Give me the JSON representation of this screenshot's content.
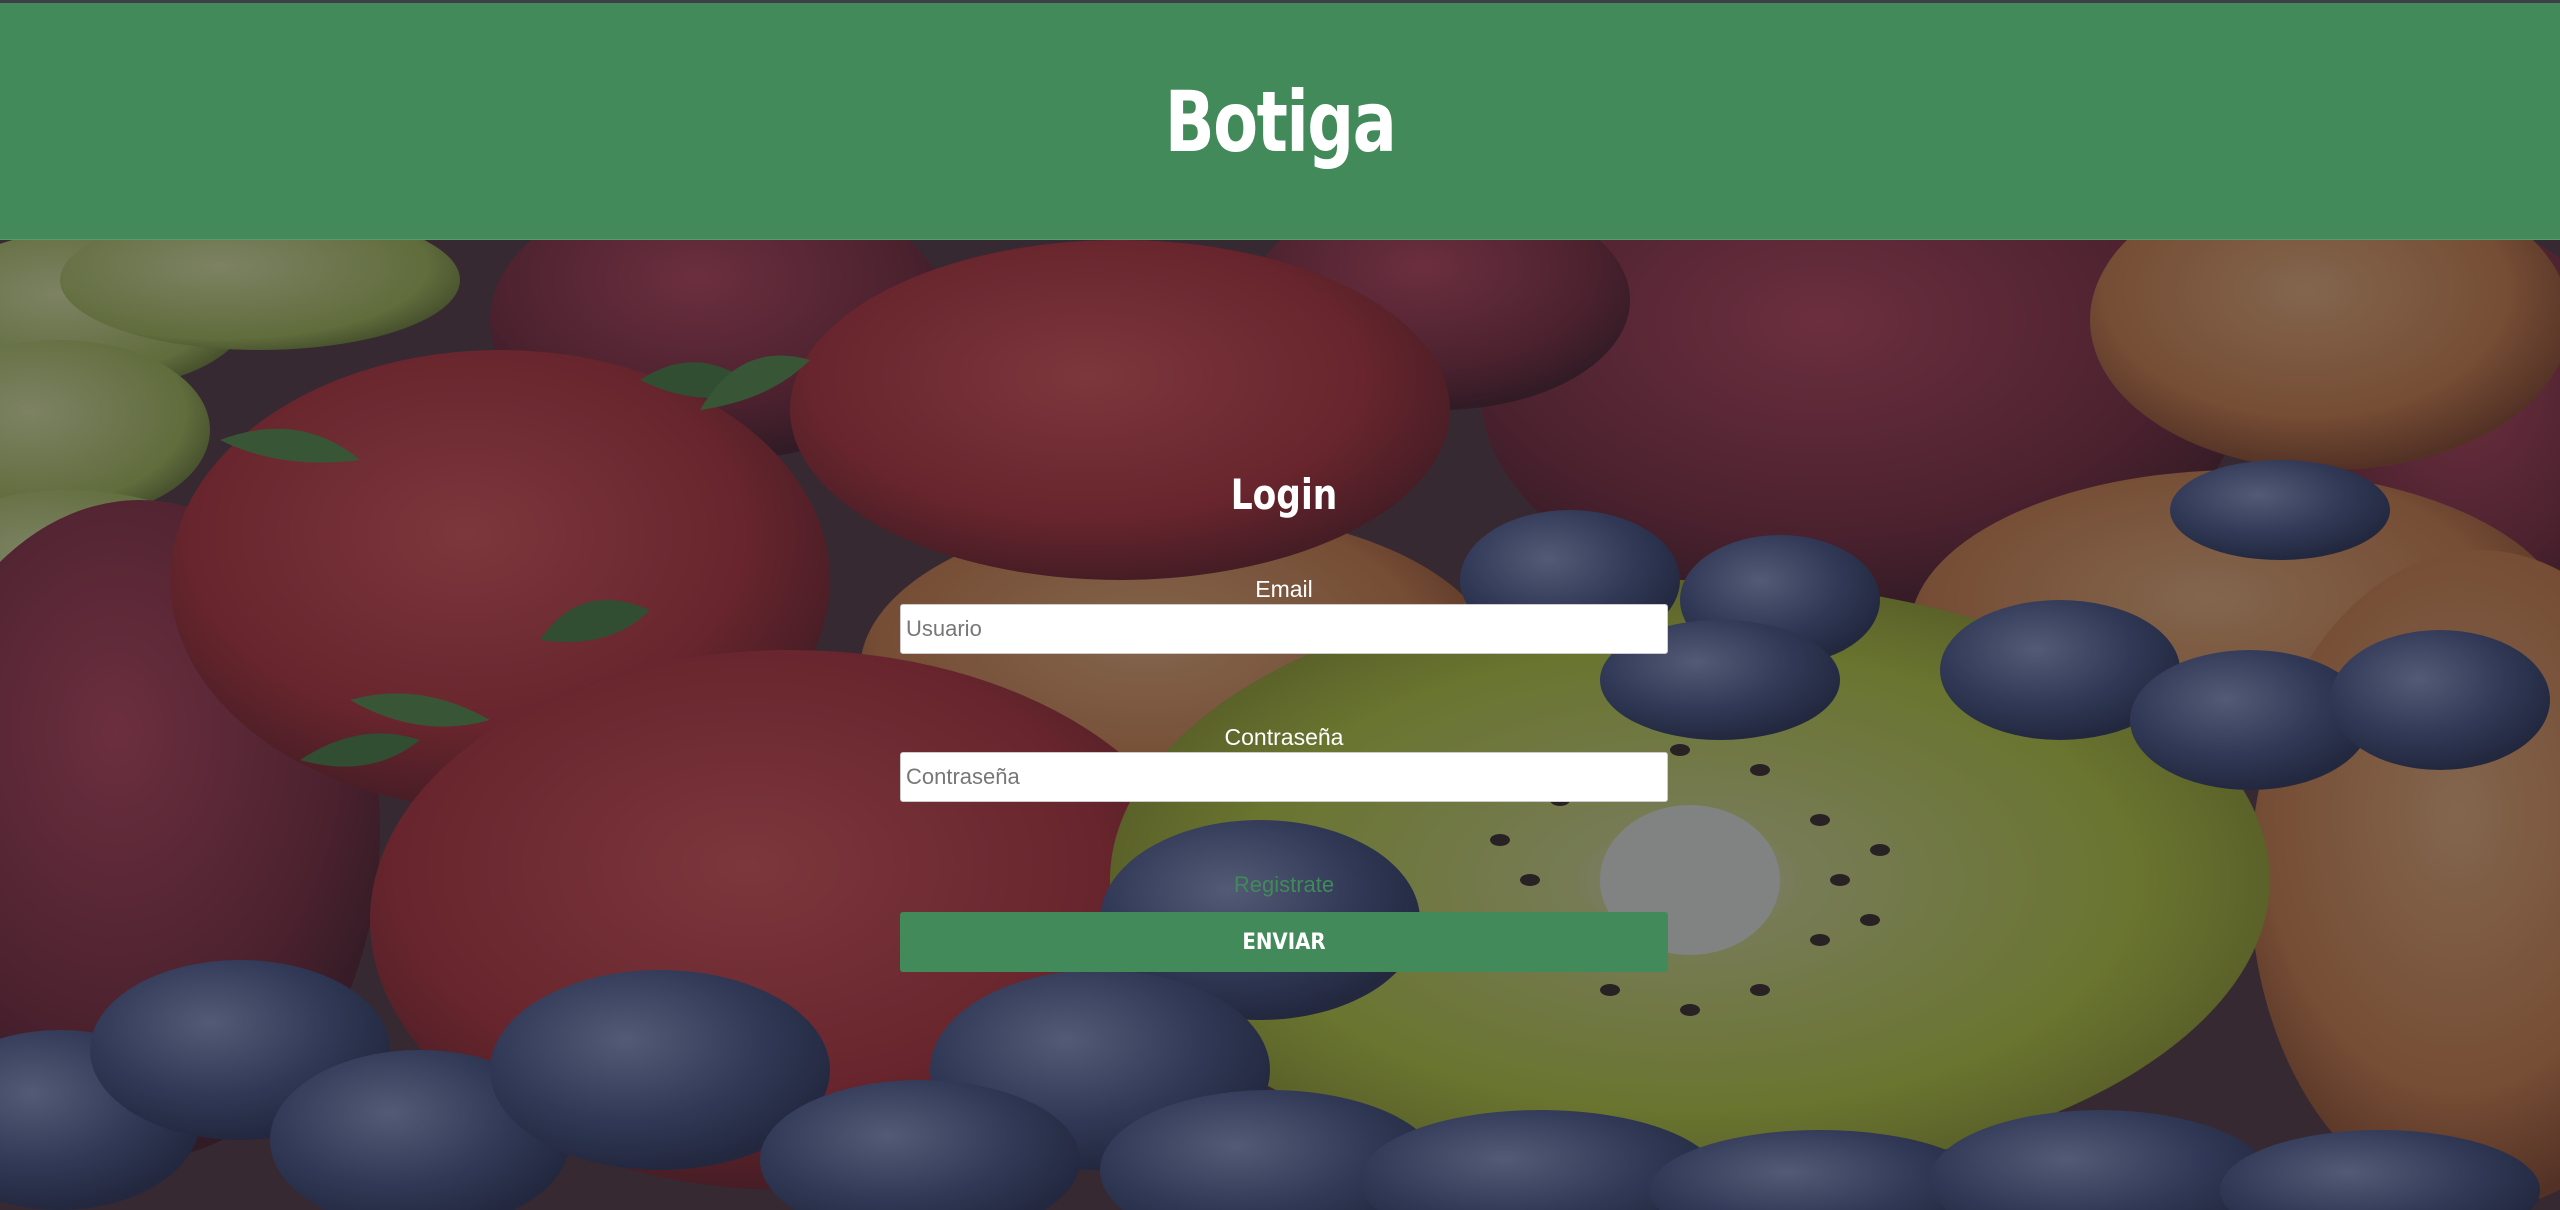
{
  "header": {
    "brand": "Botiga",
    "color": "#428a5a"
  },
  "login": {
    "title": "Login",
    "email_label": "Email",
    "email_placeholder": "Usuario",
    "password_label": "Contraseña",
    "password_placeholder": "Contraseña",
    "register_link": "Registrate",
    "submit_label": "ENVIAR"
  },
  "colors": {
    "accent": "#428a5a",
    "link": "#3f8b58"
  }
}
